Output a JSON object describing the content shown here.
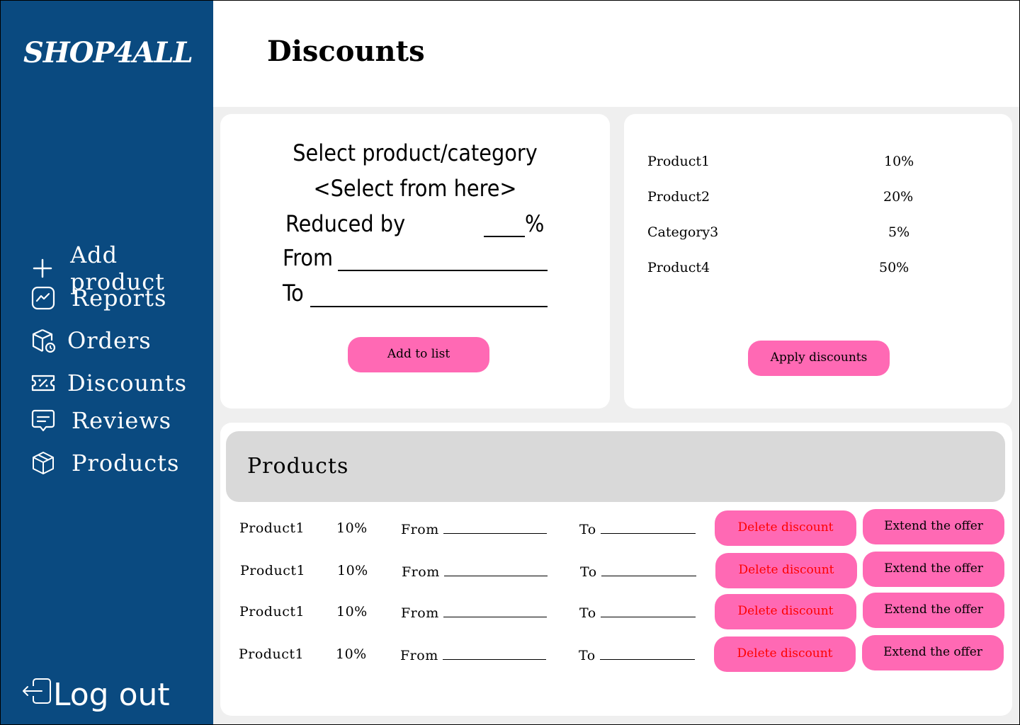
{
  "brand": {
    "logo_text": "SHOP4ALL"
  },
  "sidebar": {
    "items": [
      {
        "label": "Add product",
        "icon": "plus-icon"
      },
      {
        "label": "Reports",
        "icon": "chart-line-icon"
      },
      {
        "label": "Orders",
        "icon": "package-clock-icon"
      },
      {
        "label": "Discounts",
        "icon": "discount-ticket-icon"
      },
      {
        "label": "Reviews",
        "icon": "message-icon"
      },
      {
        "label": "Products",
        "icon": "box-icon"
      }
    ],
    "logout_label": "Log out",
    "logout_icon": "logout-icon"
  },
  "header": {
    "title": "Discounts"
  },
  "form": {
    "select_label": "Select product/category",
    "select_placeholder": "<Select from here>",
    "reduced_label": "Reduced by",
    "percent_sign": "%",
    "from_label": "From",
    "to_label": "To",
    "add_button": "Add to list"
  },
  "pending_list": {
    "items": [
      {
        "name": "Product1",
        "value": "10%"
      },
      {
        "name": "Product2",
        "value": "20%"
      },
      {
        "name": "Category3",
        "value": "5%"
      },
      {
        "name": "Product4",
        "value": "50%"
      }
    ],
    "apply_button": "Apply discounts"
  },
  "products": {
    "heading": "Products",
    "rows": [
      {
        "name": "Product1",
        "discount": "10%",
        "from_label": "From",
        "to_label": "To",
        "delete": "Delete discount",
        "extend": "Extend the offer"
      },
      {
        "name": "Product1",
        "discount": "10%",
        "from_label": "From",
        "to_label": "To",
        "delete": "Delete discount",
        "extend": "Extend the offer"
      },
      {
        "name": "Product1",
        "discount": "10%",
        "from_label": "From",
        "to_label": "To",
        "delete": "Delete discount",
        "extend": "Extend the offer"
      },
      {
        "name": "Product1",
        "discount": "10%",
        "from_label": "From",
        "to_label": "To",
        "delete": "Delete discount",
        "extend": "Extend the offer"
      }
    ]
  },
  "colors": {
    "sidebar": "#0a4a80",
    "accent": "#ff69b4",
    "danger_text": "#ff0000",
    "panel": "#d9d9d9"
  }
}
